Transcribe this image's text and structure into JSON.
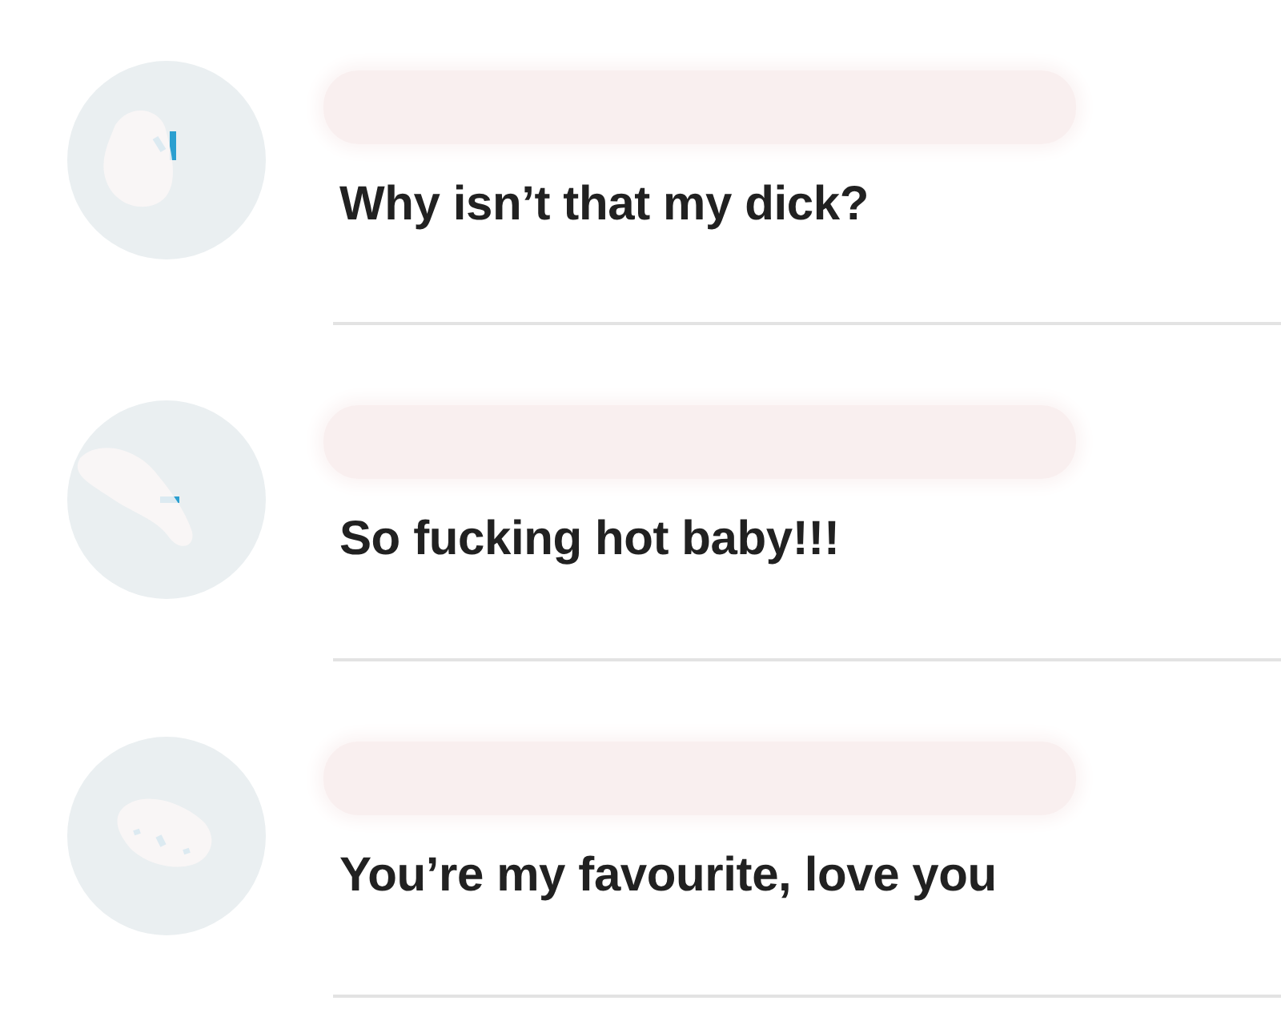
{
  "comments": [
    {
      "avatar_redacted": true,
      "name_redacted": true,
      "text": "Why isn’t that my dick?"
    },
    {
      "avatar_redacted": true,
      "name_redacted": true,
      "text": "So fucking hot baby!!!"
    },
    {
      "avatar_redacted": true,
      "name_redacted": true,
      "text": "You’re my favourite, love you"
    }
  ]
}
